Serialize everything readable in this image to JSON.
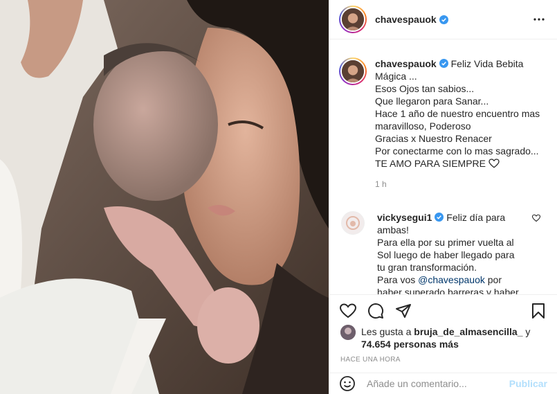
{
  "post": {
    "username": "chavespauok",
    "verified": true,
    "more_icon": "more-horizontal-icon"
  },
  "caption": {
    "username": "chavespauok",
    "lines": [
      "Feliz Vida Bebita",
      "Mágica ...",
      "Esos Ojos tan sabios...",
      "Que llegaron para Sanar...",
      "Hace 1 año de nuestro encuentro mas",
      "maravilloso, Poderoso",
      "Gracias x Nuestro Renacer",
      "Por conectarme con lo mas sagrado...",
      "TE AMO PARA SIEMPRE"
    ],
    "time": "1 h"
  },
  "comment": {
    "username": "vickysegui1",
    "lines": [
      "Feliz día para",
      "ambas!",
      "Para ella por su primer vuelta al",
      "Sol luego de haber llegado para",
      "tu gran transformación.",
      "Para vos",
      "@chavespauok",
      "por",
      "haber superado barreras y haber"
    ]
  },
  "likes": {
    "prefix": "Les gusta a",
    "user": "bruja_de_almasencilla_",
    "joiner": "y",
    "count": "74.654 personas más"
  },
  "timestamp": "HACE UNA HORA",
  "add_comment": {
    "placeholder": "Añade un comentario...",
    "publish_label": "Publicar"
  },
  "colors": {
    "verified": "#3897f0",
    "link": "#00376b",
    "publish_disabled": "#b2dffc",
    "muted": "#8e8e8e"
  }
}
